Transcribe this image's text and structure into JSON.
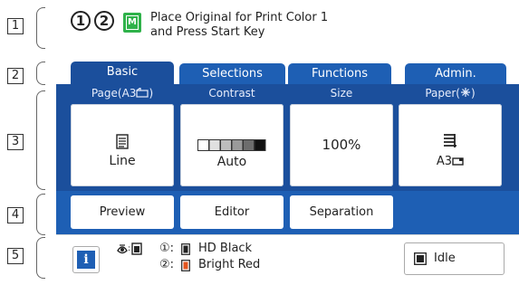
{
  "callouts": [
    "1",
    "2",
    "3",
    "4",
    "5"
  ],
  "header": {
    "drum_numbers": [
      "1",
      "2"
    ],
    "mode_badge": "M",
    "message_line1": "Place Original for Print Color 1",
    "message_line2": "and Press Start Key"
  },
  "tabs": [
    "Basic",
    "Selections",
    "Functions",
    "Admin."
  ],
  "active_tab": "Basic",
  "main": {
    "page": {
      "label": "Page(A3",
      "value": "Line"
    },
    "contrast": {
      "label": "Contrast",
      "value": "Auto"
    },
    "size": {
      "label": "Size",
      "value": "100%"
    },
    "paper": {
      "label": "Paper(",
      "label_close": ")",
      "value": "A3"
    }
  },
  "actions": [
    "Preview",
    "Editor",
    "Separation"
  ],
  "status": {
    "info": "i",
    "ink1_prefix": "①:",
    "ink1": "HD Black",
    "ink2_prefix": "②:",
    "ink2": "Bright Red",
    "state": "Idle"
  },
  "colors": {
    "primary_blue": "#1e5fb4",
    "dark_blue": "#1b4f9c",
    "mode_green": "#2fb24a",
    "ink1": "#222222",
    "ink2": "#e2541f"
  }
}
